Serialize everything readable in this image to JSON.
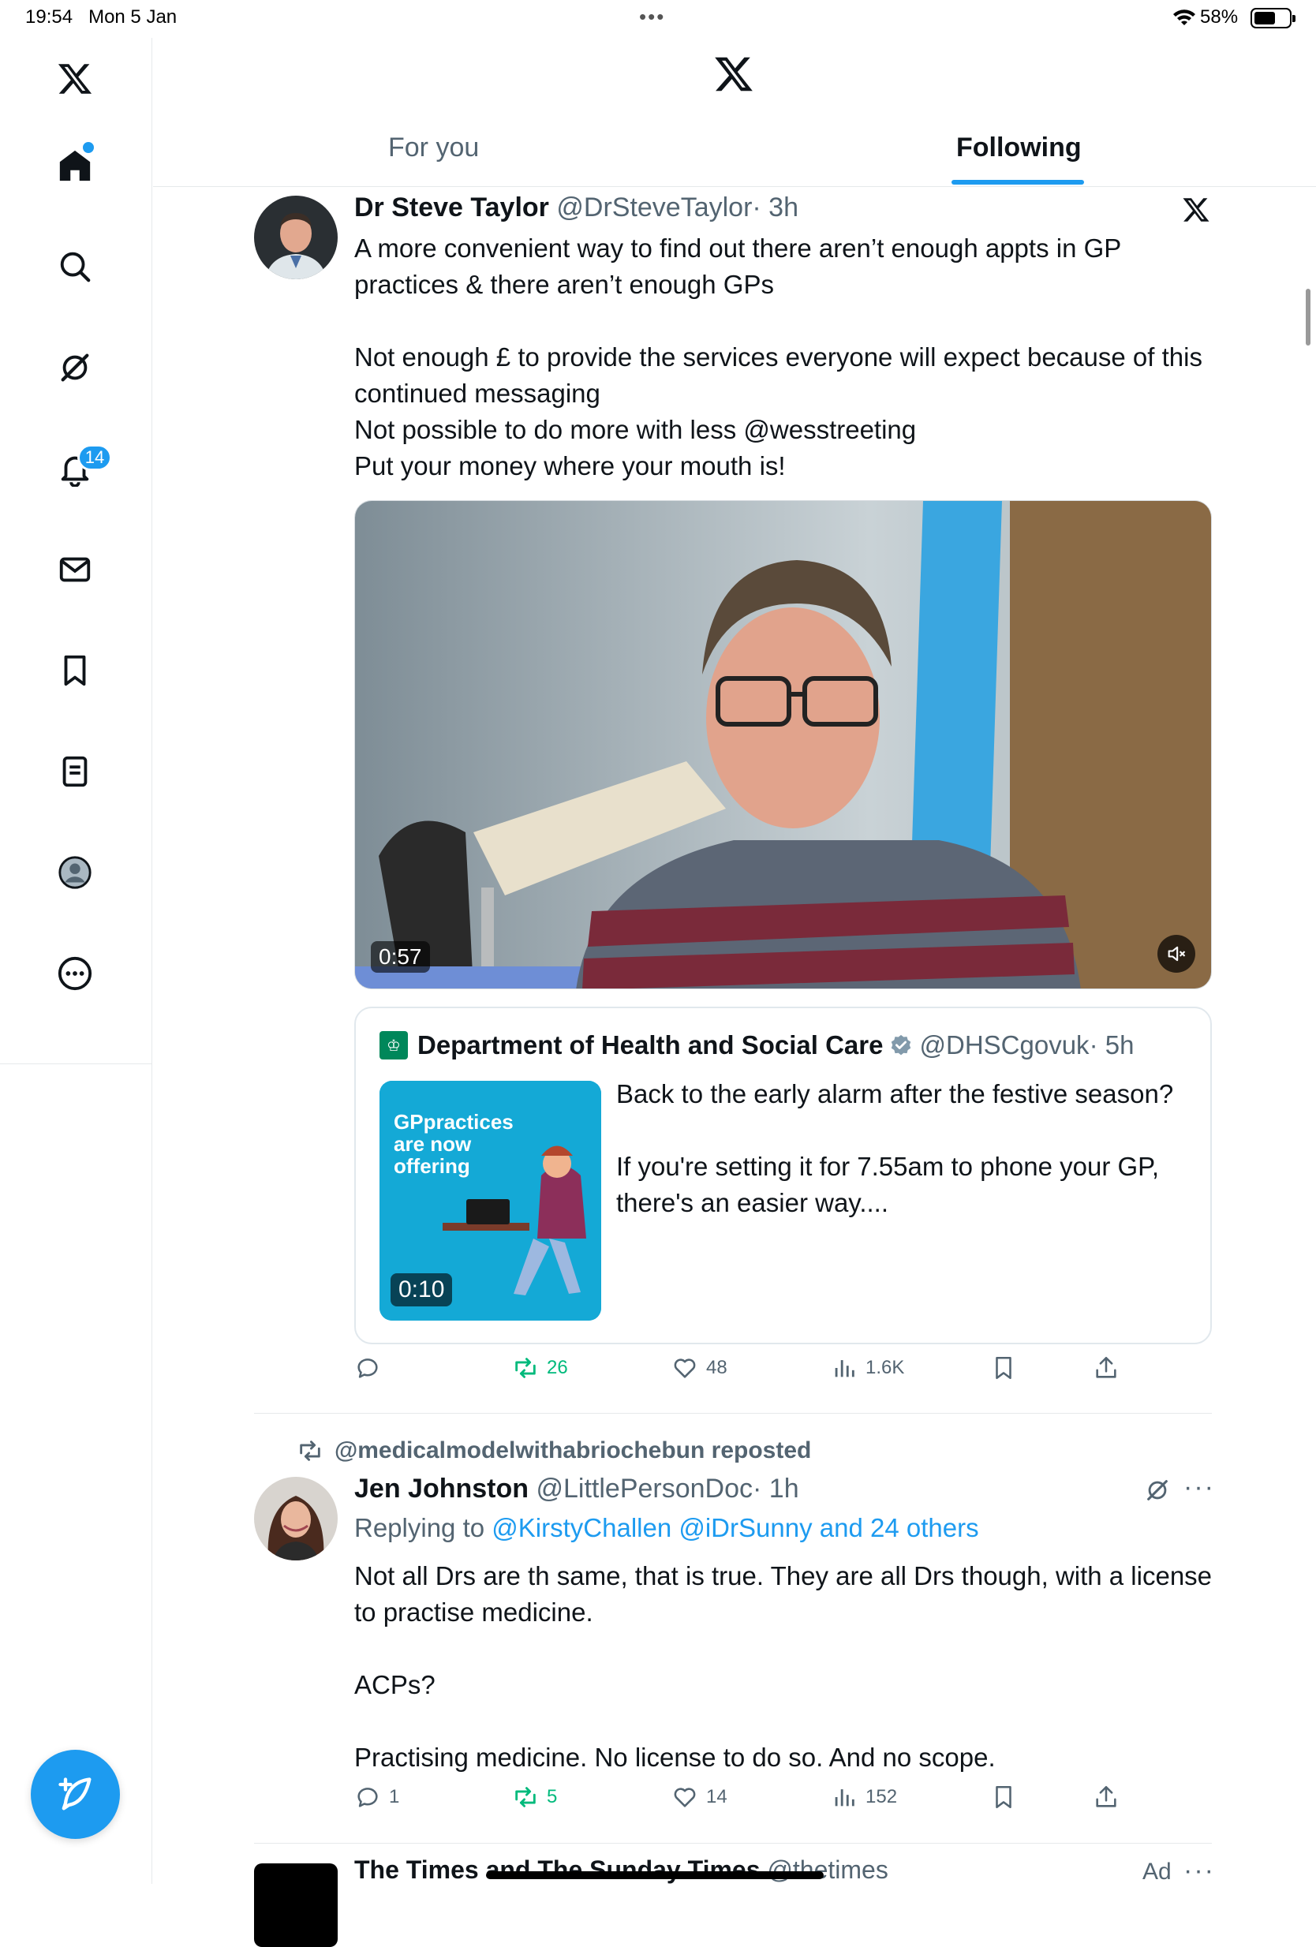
{
  "status_bar": {
    "time": "19:54",
    "date": "Mon 5 Jan",
    "battery": "58%",
    "battery_level": 0.58
  },
  "header": {
    "tabs": [
      {
        "label": "For you",
        "active": false
      },
      {
        "label": "Following",
        "active": true
      }
    ]
  },
  "sidebar": {
    "items": [
      {
        "name": "home",
        "icon": "home-icon"
      },
      {
        "name": "search",
        "icon": "search-icon"
      },
      {
        "name": "grok",
        "icon": "grok-icon"
      },
      {
        "name": "notifications",
        "icon": "bell-icon",
        "badge": "14"
      },
      {
        "name": "messages",
        "icon": "mail-icon"
      },
      {
        "name": "bookmarks",
        "icon": "bookmark-icon"
      },
      {
        "name": "lists",
        "icon": "list-icon"
      },
      {
        "name": "profile",
        "icon": "profile-icon"
      },
      {
        "name": "more",
        "icon": "more-circle-icon"
      }
    ],
    "compose_icon": "compose-icon"
  },
  "tweets": [
    {
      "name": "Dr Steve Taylor",
      "handle": "@DrSteveTaylor",
      "time": "· 3h",
      "text": "A more convenient way to find out there aren’t enough appts in GP practices & there aren’t enough GPs\n\nNot enough £ to provide the services everyone will expect because of this continued messaging\nNot possible to do more with less @wesstreeting\nPut your money where your mouth is!",
      "video_duration": "0:57",
      "quote": {
        "name": "Department of Health and Social Care",
        "handle": "@DHSCgovuk",
        "time": "· 5h",
        "text": "Back to the early alarm after the festive season?\n\nIf you're setting it for 7.55am to phone your GP, there's an easier way....",
        "media_text": "GPpractices\nare now\noffering",
        "media_duration": "0:10"
      },
      "stats": {
        "replies": "",
        "reposts": "26",
        "likes": "48",
        "views": "1.6K"
      }
    },
    {
      "repost_by": "@medicalmodelwithabriochebun reposted",
      "name": "Jen Johnston",
      "handle": "@LittlePersonDoc",
      "time": "· 1h",
      "replying_prefix": "Replying to",
      "replying_to": "@KirstyChallen @iDrSunny and 24 others",
      "text": "Not all Drs are th same, that is true. They are all Drs though, with a license to practise medicine.\n\nACPs?\n\nPractising medicine. No license to do so. And no scope.",
      "stats": {
        "replies": "1",
        "reposts": "5",
        "likes": "14",
        "views": "152"
      }
    },
    {
      "name": "The Times and The Sunday Times",
      "handle": "@thetimes",
      "ad_label": "Ad"
    }
  ],
  "colors": {
    "accent": "#1d9bf0",
    "repost": "#00ba7c",
    "muted": "#536471",
    "text": "#0f1419"
  }
}
